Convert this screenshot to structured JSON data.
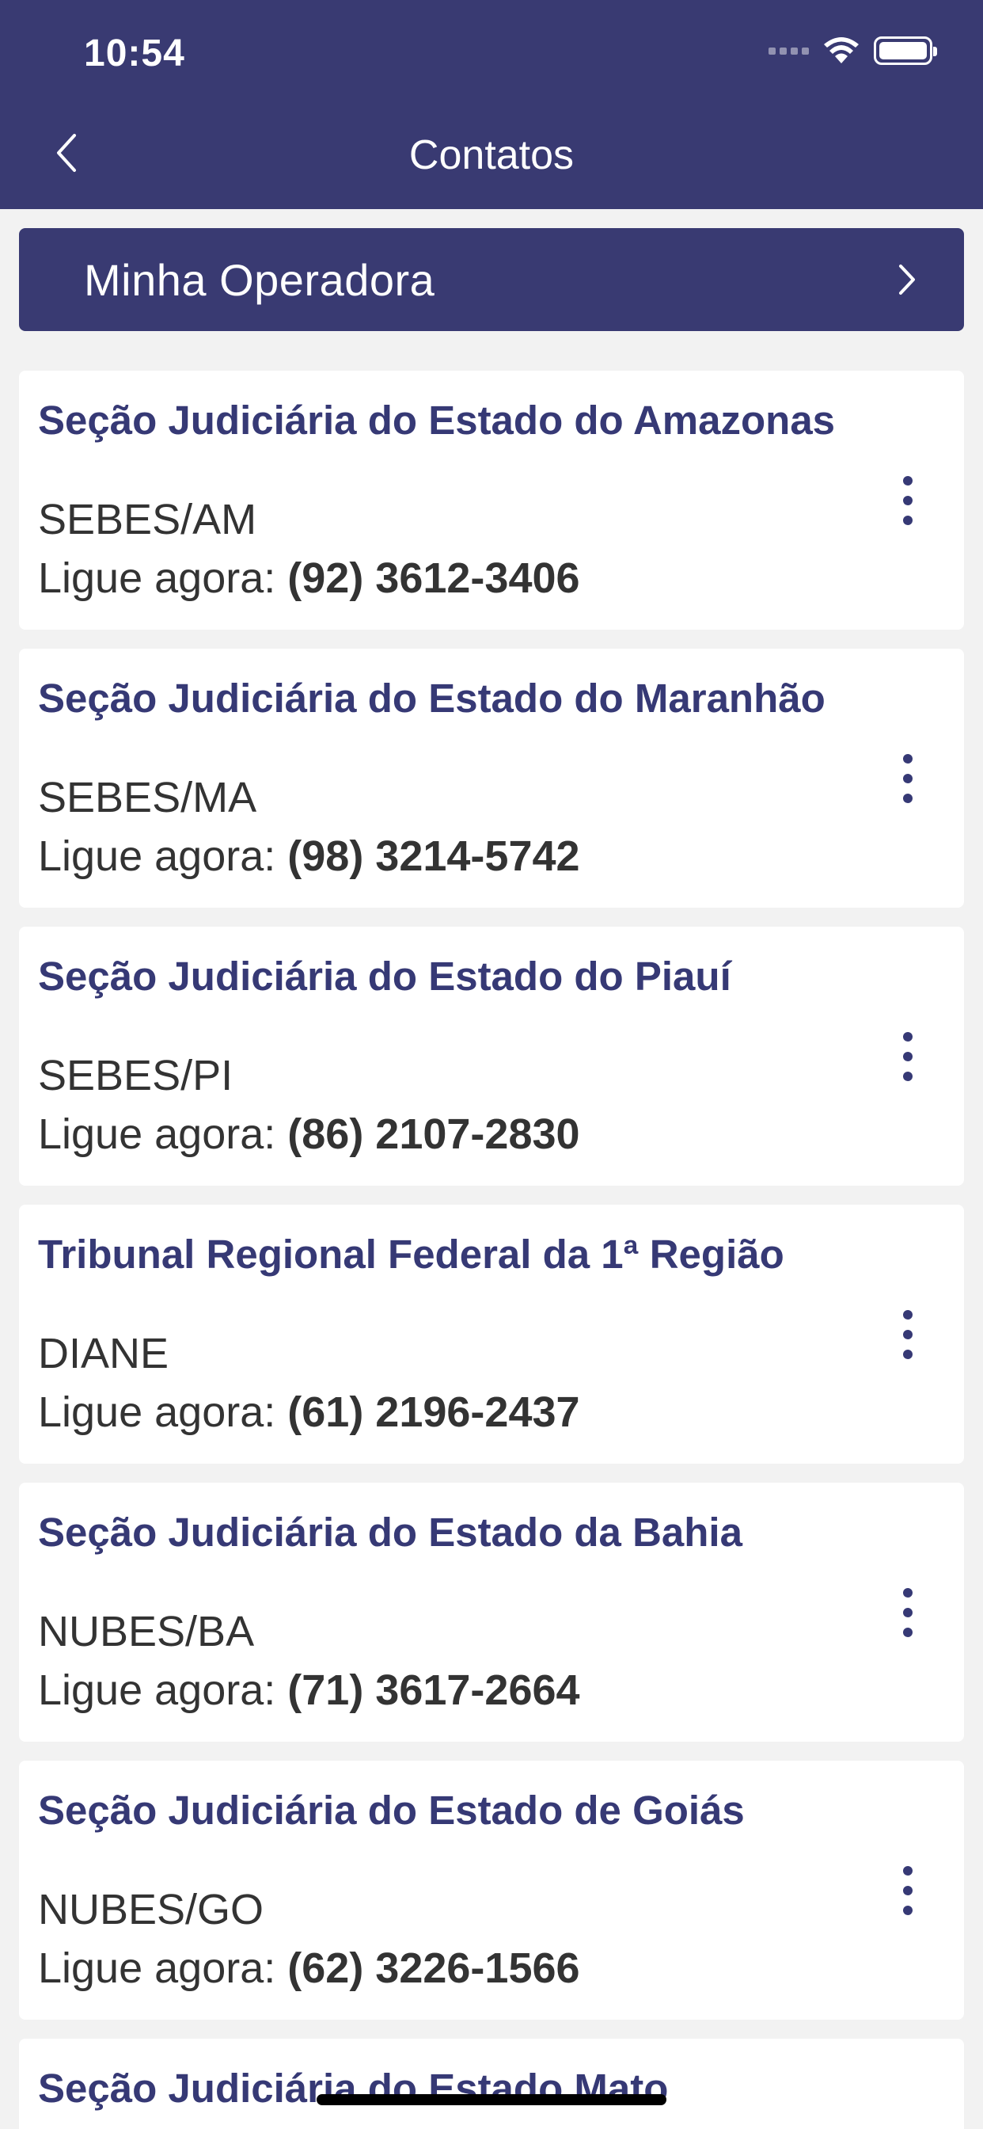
{
  "status_bar": {
    "time": "10:54"
  },
  "header": {
    "title": "Contatos"
  },
  "operator": {
    "label": "Minha Operadora"
  },
  "phone_prefix": "Ligue agora:",
  "contacts": [
    {
      "title": "Seção Judiciária do Estado do Amazonas",
      "code": "SEBES/AM",
      "phone": "(92) 3612-3406"
    },
    {
      "title": "Seção Judiciária do Estado do Maranhão",
      "code": "SEBES/MA",
      "phone": "(98) 3214-5742"
    },
    {
      "title": "Seção Judiciária do Estado do Piauí",
      "code": "SEBES/PI",
      "phone": "(86) 2107-2830"
    },
    {
      "title": "Tribunal Regional Federal da 1ª Região",
      "code": "DIANE",
      "phone": "(61) 2196-2437"
    },
    {
      "title": "Seção Judiciária do Estado da Bahia",
      "code": "NUBES/BA",
      "phone": "(71) 3617-2664"
    },
    {
      "title": "Seção Judiciária do Estado de Goiás",
      "code": "NUBES/GO",
      "phone": "(62) 3226-1566"
    },
    {
      "title": "Seção Judiciária do Estado Mato",
      "code": "",
      "phone": ""
    }
  ],
  "colors": {
    "primary": "#393a72",
    "title_text": "#363975",
    "background": "#f2f2f2"
  },
  "icons": [
    "back-chevron-icon",
    "chevron-right-icon",
    "more-vertical-icon",
    "wifi-icon",
    "battery-icon",
    "signal-icon"
  ]
}
